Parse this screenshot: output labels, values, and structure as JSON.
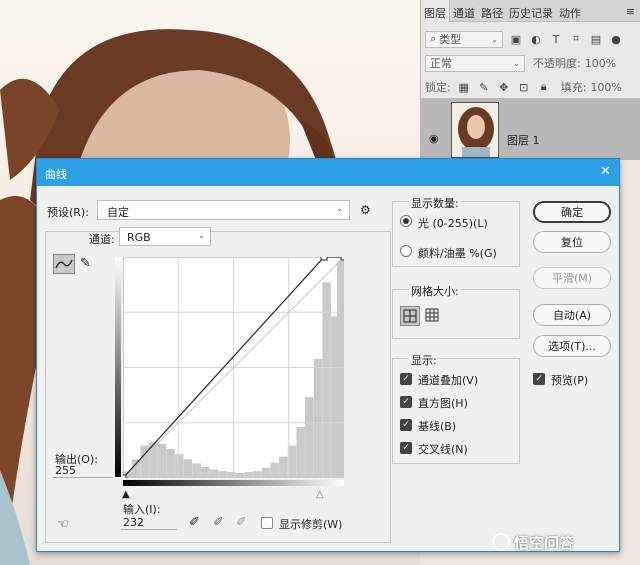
{
  "layers_panel": {
    "tabs": [
      "图层",
      "通道",
      "路径",
      "历史记录",
      "动作"
    ],
    "filter_kind": "类型",
    "blend_mode": "正常",
    "opacity_label": "不透明度:",
    "opacity_value": "100%",
    "lock_label": "锁定:",
    "fill_label": "填充:",
    "fill_value": "100%",
    "layer_name": "图层 1"
  },
  "dialog": {
    "title": "曲线",
    "preset_label": "预设(R):",
    "preset_value": "自定",
    "channel_label": "通道:",
    "channel_value": "RGB",
    "output_label": "输出(O):",
    "output_value": "255",
    "input_label": "输入(I):",
    "input_value": "232",
    "show_clipping_label": "显示修剪(W)",
    "show_amount_title": "显示数量:",
    "light_option": "光 (0-255)(L)",
    "pigment_option": "颜料/油墨 %(G)",
    "grid_size_title": "网格大小:",
    "show_title": "显示:",
    "show_options": [
      "通道叠加(V)",
      "直方图(H)",
      "基线(B)",
      "交叉线(N)"
    ],
    "buttons": {
      "ok": "确定",
      "reset": "复位",
      "smooth": "平滑(M)",
      "auto": "自动(A)",
      "options": "选项(T)..."
    },
    "preview_label": "预览(P)"
  },
  "watermark": "悟空问答",
  "chart_data": {
    "type": "area",
    "title": "",
    "xlabel": "输入(I)",
    "ylabel": "输出(O)",
    "xlim": [
      0,
      255
    ],
    "ylim": [
      0,
      255
    ],
    "grid": true,
    "curve_points": [
      [
        0,
        0
      ],
      [
        232,
        255
      ],
      [
        255,
        255
      ]
    ],
    "histogram": {
      "x": [
        5,
        15,
        25,
        35,
        45,
        55,
        65,
        75,
        85,
        95,
        105,
        115,
        125,
        135,
        145,
        155,
        165,
        175,
        185,
        195,
        205,
        215,
        225,
        235,
        245,
        252
      ],
      "values": [
        8,
        22,
        38,
        42,
        40,
        34,
        28,
        22,
        17,
        13,
        10,
        8,
        7,
        6,
        7,
        8,
        12,
        18,
        25,
        38,
        60,
        95,
        140,
        230,
        190,
        255
      ]
    }
  }
}
